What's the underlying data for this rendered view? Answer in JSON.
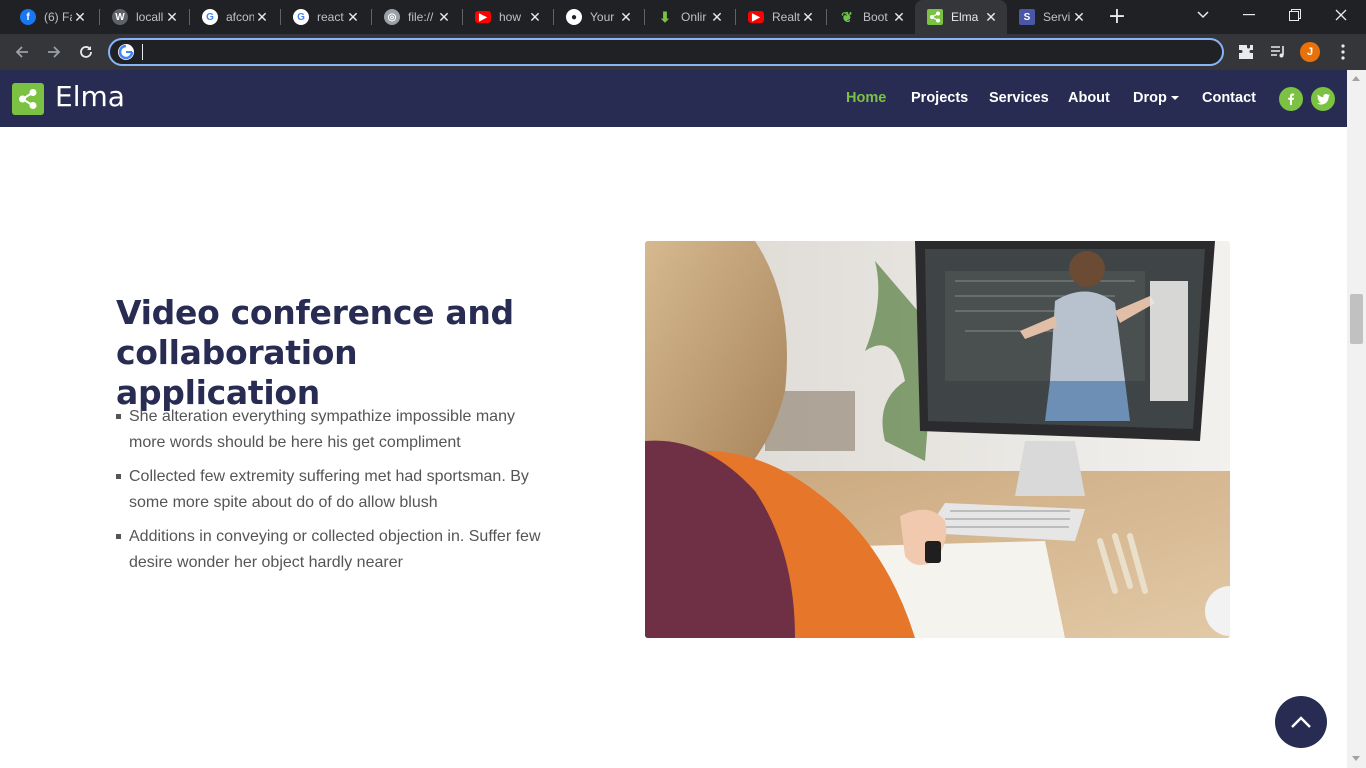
{
  "browser": {
    "tabs": [
      {
        "title": "(6) Fa",
        "favicon": "facebook-icon",
        "color": "#1877f2"
      },
      {
        "title": "locall",
        "favicon": "wordpress-icon",
        "color": "#9aa0a6"
      },
      {
        "title": "afcon",
        "favicon": "google-icon",
        "color": "#ffffff"
      },
      {
        "title": "react",
        "favicon": "google-icon",
        "color": "#ffffff"
      },
      {
        "title": "file://",
        "favicon": "globe-icon",
        "color": "#9aa0a6"
      },
      {
        "title": "how",
        "favicon": "youtube-icon",
        "color": "#ff0000"
      },
      {
        "title": "Your",
        "favicon": "github-icon",
        "color": "#ffffff"
      },
      {
        "title": "Onlir",
        "favicon": "download-icon",
        "color": "#7cc242"
      },
      {
        "title": "Realt",
        "favicon": "youtube-icon",
        "color": "#ff0000"
      },
      {
        "title": "Boot",
        "favicon": "leaf-icon",
        "color": "#6cc24a"
      },
      {
        "title": "Elma",
        "favicon": "share-icon",
        "color": "#7cc242",
        "active": true
      },
      {
        "title": "Servi",
        "favicon": "s-icon",
        "color": "#4a56a6"
      }
    ],
    "address_bar": {
      "value": "",
      "placeholder": ""
    },
    "profile_initial": "J"
  },
  "site": {
    "brand": "Elma",
    "nav": {
      "home": "Home",
      "projects": "Projects",
      "services": "Services",
      "about": "About",
      "drop": "Drop",
      "contact": "Contact"
    },
    "social": [
      "facebook-icon",
      "twitter-icon"
    ],
    "accent": "#7cc242",
    "navy": "#282c52"
  },
  "feature": {
    "heading": "Video conference and collaboration application",
    "bullets": [
      "She alteration everything sympathize impossible many more words should be here his get compliment",
      "Collected few extremity suffering met had sportsman. By some more spite about do of do allow blush",
      "Additions in conveying or collected objection in. Suffer few desire wonder her object hardly nearer"
    ]
  }
}
